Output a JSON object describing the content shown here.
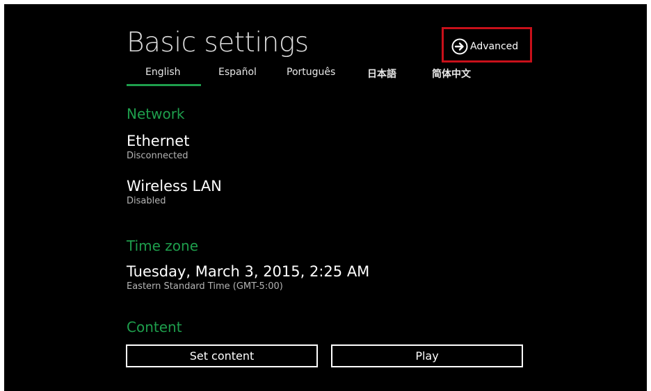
{
  "header": {
    "title": "Basic settings",
    "advanced_label": "Advanced",
    "advanced_icon": "arrow-right-circle-icon"
  },
  "languages": {
    "selected": "English",
    "tabs": [
      "English",
      "Español",
      "Português",
      "日本語",
      "简体中文"
    ]
  },
  "network": {
    "heading": "Network",
    "ethernet": {
      "title": "Ethernet",
      "status": "Disconnected"
    },
    "wireless": {
      "title": "Wireless LAN",
      "status": "Disabled"
    }
  },
  "timezone": {
    "heading": "Time zone",
    "datetime": "Tuesday, March 3, 2015, 2:25 AM",
    "zone": "Eastern Standard Time (GMT-5:00)"
  },
  "content": {
    "heading": "Content",
    "set_content_label": "Set content",
    "play_label": "Play"
  },
  "colors": {
    "accent": "#1e9e4c",
    "highlight_box": "#c8101a",
    "background": "#000000"
  }
}
